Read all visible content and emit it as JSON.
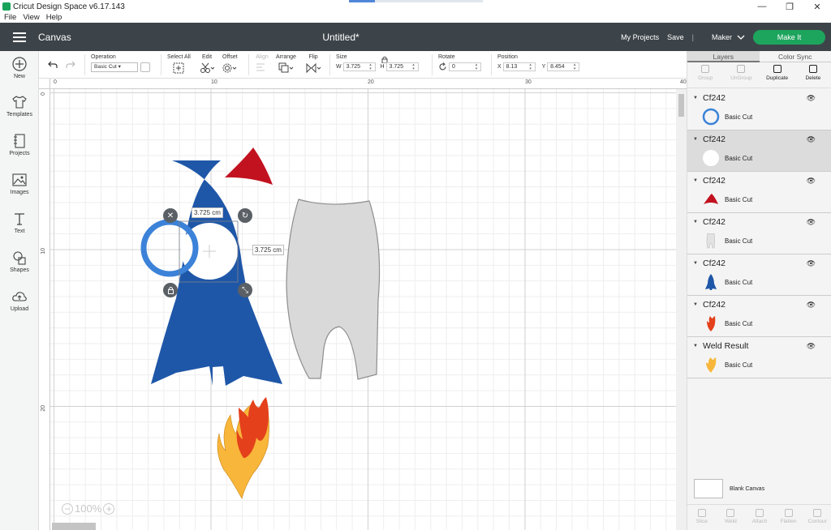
{
  "window": {
    "app_title": "Cricut Design Space  v6.17.143",
    "minimize": "—",
    "maximize": "❐",
    "close": "✕"
  },
  "menu": [
    "File",
    "View",
    "Help"
  ],
  "header": {
    "section": "Canvas",
    "doc_title": "Untitled*",
    "my_projects": "My Projects",
    "save": "Save",
    "separator": "|",
    "machine": "Maker",
    "make_it": "Make It"
  },
  "sidebar": [
    {
      "label": "New",
      "icon": "plus-circle-icon"
    },
    {
      "label": "Templates",
      "icon": "tshirt-icon"
    },
    {
      "label": "Projects",
      "icon": "notebook-icon"
    },
    {
      "label": "Images",
      "icon": "image-icon"
    },
    {
      "label": "Text",
      "icon": "text-t-icon"
    },
    {
      "label": "Shapes",
      "icon": "shapes-icon"
    },
    {
      "label": "Upload",
      "icon": "cloud-upload-icon"
    }
  ],
  "toolbar": {
    "operation_label": "Operation",
    "operation_value": "Basic Cut",
    "select_all": "Select All",
    "edit": "Edit",
    "offset": "Offset",
    "align": "Align",
    "arrange": "Arrange",
    "flip": "Flip",
    "size_label": "Size",
    "w_label": "W",
    "w_value": "3.725",
    "h_label": "H",
    "h_value": "3.725",
    "rotate_label": "Rotate",
    "rotate_value": "0",
    "position_label": "Position",
    "x_label": "X",
    "x_value": "8.13",
    "y_label": "Y",
    "y_value": "8.454"
  },
  "rulers": {
    "top": [
      "0",
      "10",
      "20",
      "30",
      "40"
    ],
    "left": [
      "0",
      "10",
      "20"
    ]
  },
  "canvas": {
    "width_label": "3.725 cm",
    "height_label": "3.725 cm",
    "zoom": "100%",
    "zoom_out": "−",
    "zoom_in": "+",
    "colors": {
      "rocket_blue": "#1f57a8",
      "ring_blue": "#3b82d8",
      "nose_red": "#c2121f",
      "pants_gray": "#d9d9d9",
      "flame_red": "#e4401c",
      "flame_orange": "#f29a20",
      "flame_yellow": "#f8b63a"
    }
  },
  "panel": {
    "tabs": [
      "Layers",
      "Color Sync"
    ],
    "actions": [
      "Group",
      "UnGroup",
      "Duplicate",
      "Delete"
    ],
    "layers": [
      {
        "name": "Cf242",
        "op": "Basic Cut",
        "thumb": "ring"
      },
      {
        "name": "Cf242",
        "op": "Basic Cut",
        "thumb": "white-circle"
      },
      {
        "name": "Cf242",
        "op": "Basic Cut",
        "thumb": "red-triangle"
      },
      {
        "name": "Cf242",
        "op": "Basic Cut",
        "thumb": "gray-pants"
      },
      {
        "name": "Cf242",
        "op": "Basic Cut",
        "thumb": "blue-rocket"
      },
      {
        "name": "Cf242",
        "op": "Basic Cut",
        "thumb": "red-flame"
      },
      {
        "name": "Weld Result",
        "op": "Basic Cut",
        "thumb": "yellow-flame"
      }
    ],
    "blank_canvas": "Blank Canvas",
    "bottom_tools": [
      "Slice",
      "Weld",
      "Attach",
      "Flatten",
      "Contour"
    ]
  }
}
